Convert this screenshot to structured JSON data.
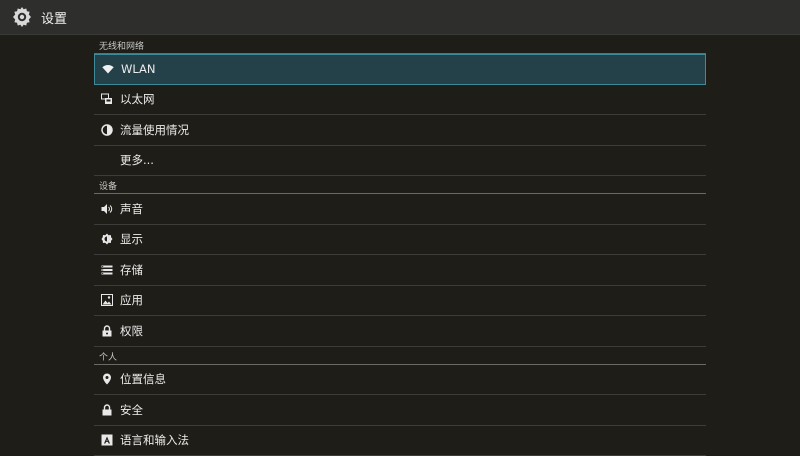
{
  "app": {
    "title": "设置",
    "icon": "gear-icon"
  },
  "sections": [
    {
      "header": "无线和网络",
      "items": [
        {
          "label": "WLAN",
          "icon": "wifi-icon",
          "selected": true
        },
        {
          "label": "以太网",
          "icon": "ethernet-icon"
        },
        {
          "label": "流量使用情况",
          "icon": "data-usage-icon"
        },
        {
          "label": "更多...",
          "icon": ""
        }
      ]
    },
    {
      "header": "设备",
      "items": [
        {
          "label": "声音",
          "icon": "speaker-icon"
        },
        {
          "label": "显示",
          "icon": "brightness-icon"
        },
        {
          "label": "存储",
          "icon": "storage-icon"
        },
        {
          "label": "应用",
          "icon": "apps-icon"
        },
        {
          "label": "权限",
          "icon": "lock-icon"
        }
      ]
    },
    {
      "header": "个人",
      "items": [
        {
          "label": "位置信息",
          "icon": "location-pin-icon"
        },
        {
          "label": "安全",
          "icon": "lock-icon"
        },
        {
          "label": "语言和输入法",
          "icon": "language-icon"
        }
      ]
    }
  ],
  "colors": {
    "background": "#1e1d17",
    "titlebar": "#2e2e2c",
    "selected_bg": "#244049",
    "selected_border": "#3d8a9a"
  }
}
